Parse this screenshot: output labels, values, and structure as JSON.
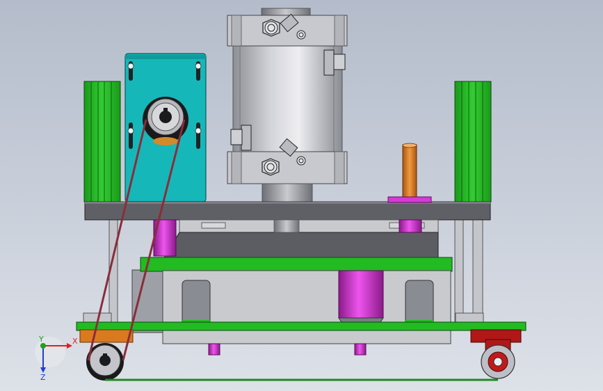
{
  "viewport": {
    "background_top": "#b4bccb",
    "background_bottom": "#dde1e8"
  },
  "colors": {
    "green": "#22bb22",
    "green_dark": "#1a8f1a",
    "teal": "#14b8b8",
    "gray_dark": "#5f6066",
    "gray_light": "#c9c9cc",
    "gray_mid": "#9a9ba0",
    "magenta": "#cc22cc",
    "orange": "#d97a1e",
    "red": "#b01818",
    "brown": "#7a2d35",
    "steel": "#a8acb6"
  },
  "triad": {
    "x_label": "X",
    "y_label": "Y",
    "z_label": "Z",
    "x_color": "#e02020",
    "y_color": "#20a020",
    "z_color": "#2040d0"
  }
}
